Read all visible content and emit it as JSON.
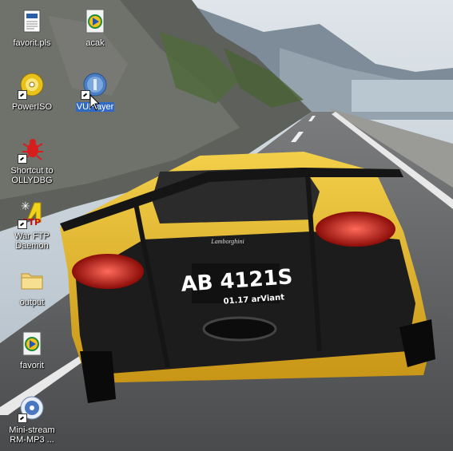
{
  "desktop": {
    "wallpaper": {
      "plate_main": "AB 4121S",
      "plate_sub": "01.17 arViant",
      "badge": "Lamborghini"
    },
    "icons": [
      {
        "label": "favorit.pls",
        "icon": "playlist-file-icon"
      },
      {
        "label": "acak",
        "icon": "media-file-icon"
      },
      {
        "label": "PowerISO",
        "icon": "poweriso-disc-icon"
      },
      {
        "label": "VUPlayer",
        "icon": "vuplayer-icon",
        "selected": true
      },
      {
        "label": "Shortcut to OLLYDBG",
        "icon": "ollydbg-bug-icon"
      },
      {
        "label": "War FTP Daemon",
        "icon": "warftp-icon"
      },
      {
        "label": "output",
        "icon": "folder-icon"
      },
      {
        "label": "favorit",
        "icon": "media-file-icon"
      },
      {
        "label": "Mini-stream RM-MP3 ...",
        "icon": "ministream-icon"
      }
    ]
  },
  "colors": {
    "selection": "#316ac5",
    "label_text": "#ffffff",
    "car_yellow": "#e6b62a",
    "sky": "#c9d3dc"
  }
}
